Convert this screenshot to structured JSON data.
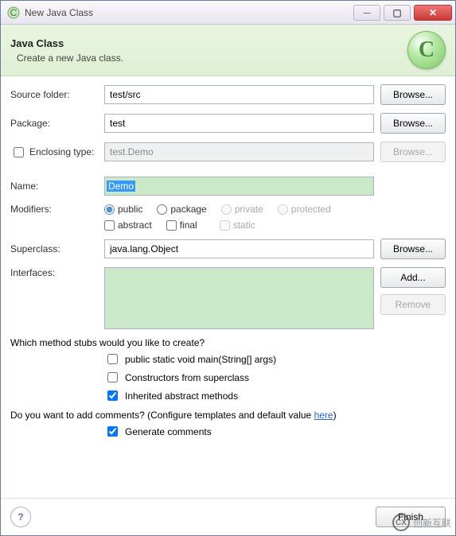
{
  "window": {
    "title": "New Java Class"
  },
  "banner": {
    "title": "Java Class",
    "description": "Create a new Java class."
  },
  "labels": {
    "source_folder": "Source folder:",
    "package": "Package:",
    "enclosing_type": "Enclosing type:",
    "name": "Name:",
    "modifiers": "Modifiers:",
    "superclass": "Superclass:",
    "interfaces": "Interfaces:"
  },
  "fields": {
    "source_folder": "test/src",
    "package": "test",
    "enclosing_type": "test.Demo",
    "name": "Demo",
    "superclass": "java.lang.Object"
  },
  "buttons": {
    "browse": "Browse...",
    "add": "Add...",
    "remove": "Remove",
    "finish": "Finish"
  },
  "modifiers": {
    "public": "public",
    "package": "package",
    "private": "private",
    "protected": "protected",
    "abstract": "abstract",
    "final": "final",
    "static": "static"
  },
  "stubs": {
    "question": "Which method stubs would you like to create?",
    "main": "public static void main(String[] args)",
    "constructors": "Constructors from superclass",
    "inherited": "Inherited abstract methods"
  },
  "comments": {
    "question_pre": "Do you want to add comments? (Configure templates and default value ",
    "link": "here",
    "question_post": ")",
    "generate": "Generate comments"
  },
  "watermark": {
    "text": "创新互联"
  }
}
